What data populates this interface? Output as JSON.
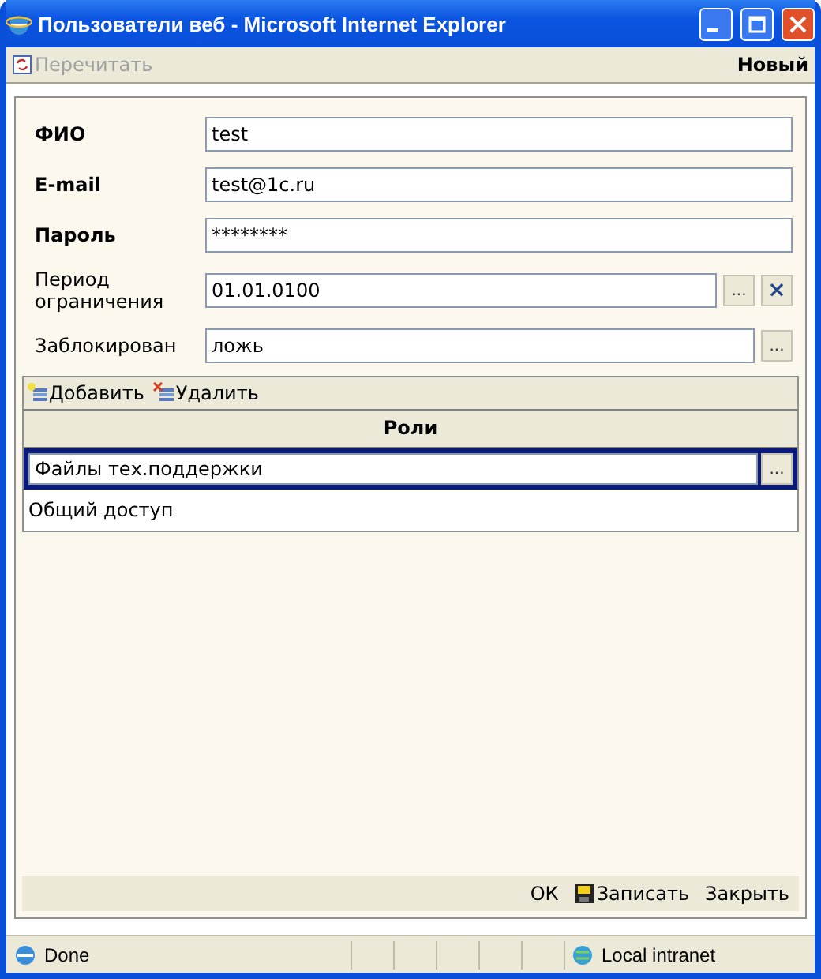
{
  "window": {
    "title": "Пользователи веб - Microsoft Internet Explorer"
  },
  "toolbar": {
    "items": [
      {
        "label": "Перечитать",
        "disabled": true
      }
    ],
    "mode": "Новый"
  },
  "fields": [
    {
      "label": "ФИО",
      "bold": true,
      "value": "test"
    },
    {
      "label": "E-mail",
      "bold": true,
      "value": "test@1c.ru"
    },
    {
      "label": "Пароль",
      "bold": true,
      "value": "********"
    },
    {
      "label": "Период ограничения",
      "bold": false,
      "value": "01.01.0100",
      "choose_button": "...",
      "clear_button": "×"
    },
    {
      "label": "Заблокирован",
      "bold": false,
      "value": "ложь",
      "choose_button": "..."
    }
  ],
  "roles": {
    "actions": [
      {
        "label": "Добавить",
        "kind": "add"
      },
      {
        "label": "Удалить",
        "kind": "delete"
      }
    ],
    "column": "Роли",
    "rows": [
      {
        "value": "Файлы тех.поддержки",
        "selected": true,
        "choose_button": "..."
      },
      {
        "value": "Общий доступ",
        "selected": false
      }
    ]
  },
  "footer_buttons": [
    {
      "label": "ОК",
      "kind": "ok"
    },
    {
      "label": "Записать",
      "kind": "save"
    },
    {
      "label": "Закрыть",
      "kind": "close"
    }
  ],
  "status_bar": {
    "text": "Done",
    "zone": "Local intranet"
  }
}
